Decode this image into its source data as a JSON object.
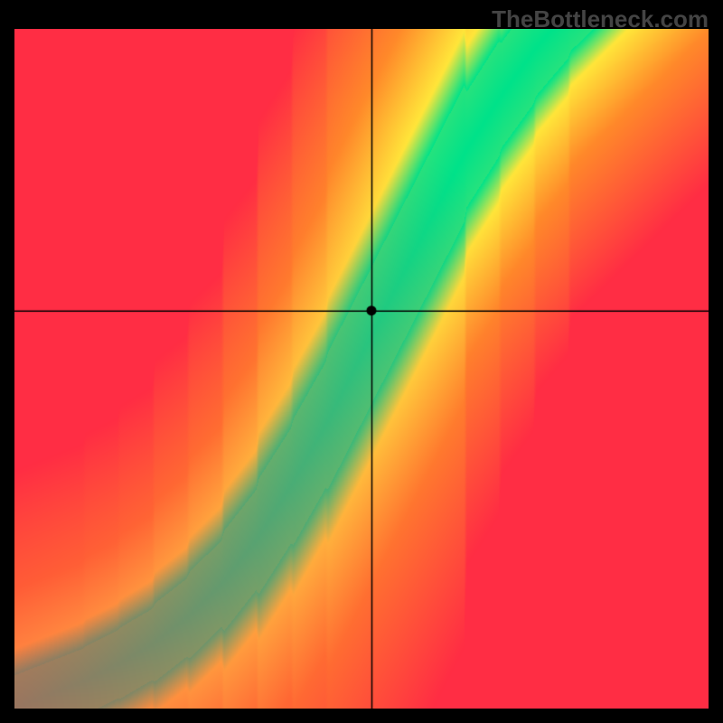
{
  "watermark": "TheBottleneck.com",
  "chart_data": {
    "type": "heatmap",
    "title": "",
    "xlabel": "",
    "ylabel": "",
    "xlim": [
      0,
      1
    ],
    "ylim": [
      0,
      1
    ],
    "crosshair": {
      "x": 0.515,
      "y": 0.585
    },
    "marker": {
      "x": 0.515,
      "y": 0.585
    },
    "ideal_curve": {
      "_comment": "Green ideal-balance ridge; distance from it drives color red→yellow→green. Points (u,v) in 0..1.",
      "points": [
        [
          0.0,
          0.0
        ],
        [
          0.05,
          0.02
        ],
        [
          0.1,
          0.04
        ],
        [
          0.15,
          0.065
        ],
        [
          0.2,
          0.095
        ],
        [
          0.25,
          0.135
        ],
        [
          0.3,
          0.185
        ],
        [
          0.35,
          0.25
        ],
        [
          0.4,
          0.33
        ],
        [
          0.45,
          0.42
        ],
        [
          0.5,
          0.52
        ],
        [
          0.55,
          0.62
        ],
        [
          0.6,
          0.72
        ],
        [
          0.65,
          0.82
        ],
        [
          0.7,
          0.9
        ],
        [
          0.75,
          0.97
        ],
        [
          0.8,
          1.03
        ],
        [
          0.85,
          1.08
        ]
      ]
    },
    "band_half_width": 0.045,
    "colors": {
      "green": "#00e28a",
      "yellow": "#ffe63a",
      "orange": "#ff8a2a",
      "red": "#ff2d44",
      "crosshair": "#000000",
      "marker": "#000000"
    },
    "grid": false,
    "legend": null
  }
}
